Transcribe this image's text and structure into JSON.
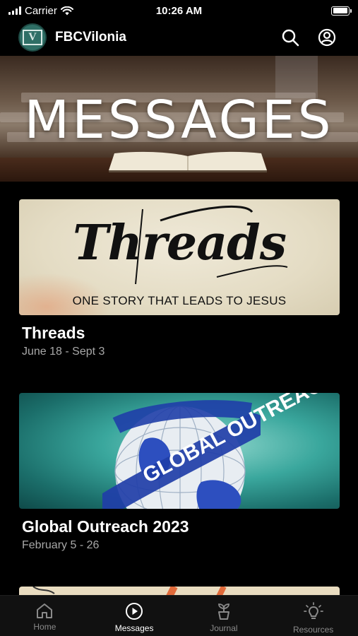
{
  "status": {
    "carrier": "Carrier",
    "time": "10:26 AM"
  },
  "header": {
    "app_name": "FBCVilonia",
    "logo_letter": "V"
  },
  "hero": {
    "title": "MESSAGES"
  },
  "series": [
    {
      "image_title": "Threads",
      "image_tagline": "ONE STORY THAT LEADS TO JESUS",
      "title": "Threads",
      "dates": "June 18 - Sept 3"
    },
    {
      "image_title": "GLOBAL OUTREACH",
      "title": "Global Outreach 2023",
      "dates": "February 5 - 26"
    }
  ],
  "tabs": [
    {
      "label": "Home",
      "icon": "home-icon",
      "active": false
    },
    {
      "label": "Messages",
      "icon": "play-circle-icon",
      "active": true
    },
    {
      "label": "Journal",
      "icon": "plant-icon",
      "active": false
    },
    {
      "label": "Resources",
      "icon": "lightbulb-icon",
      "active": false
    }
  ],
  "colors": {
    "background": "#000000",
    "tab_active": "#ffffff",
    "tab_inactive": "#8a8a8a",
    "subtitle": "#a8a8a8"
  }
}
